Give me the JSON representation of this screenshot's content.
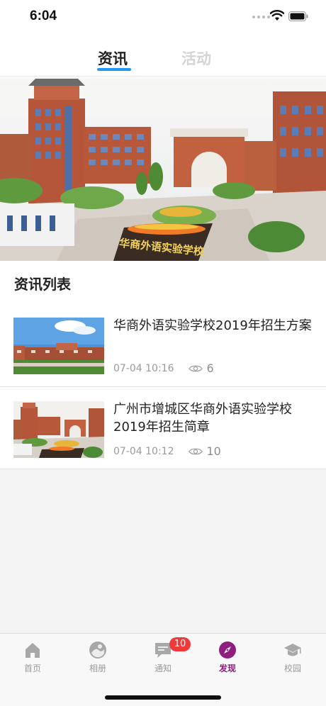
{
  "status_bar": {
    "time": "6:04"
  },
  "tabs": [
    {
      "label": "资讯",
      "active": true
    },
    {
      "label": "活动",
      "active": false
    }
  ],
  "banner": {
    "sign_text": "华商外语实验学校"
  },
  "section": {
    "title": "资讯列表"
  },
  "news": [
    {
      "title": "华商外语实验学校2019年招生方案",
      "time": "07-04 10:16",
      "views": "6"
    },
    {
      "title": "广州市增城区华商外语实验学校2019年招生简章",
      "time": "07-04 10:12",
      "views": "10"
    }
  ],
  "tabbar": {
    "items": [
      {
        "label": "首页",
        "icon": "home-icon",
        "active": false
      },
      {
        "label": "相册",
        "icon": "album-icon",
        "active": false
      },
      {
        "label": "通知",
        "icon": "notification-icon",
        "active": false,
        "badge": "10"
      },
      {
        "label": "发现",
        "icon": "discover-compass-icon",
        "active": true
      },
      {
        "label": "校园",
        "icon": "campus-graduation-cap-icon",
        "active": false
      }
    ]
  },
  "colors": {
    "accent": "#8e1f7e",
    "tab_underline": "#2196f3",
    "badge": "#f03a3a"
  }
}
